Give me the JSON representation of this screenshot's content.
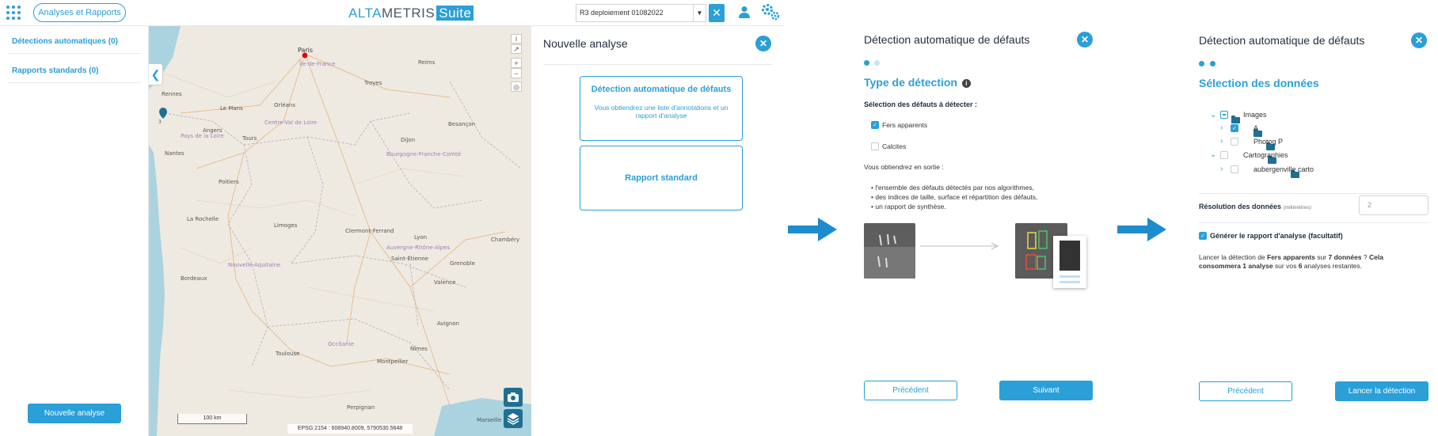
{
  "header": {
    "analyses_button": "Analyses et Rapports",
    "logo_alta": "ALTA",
    "logo_metris": "METRIS",
    "logo_suite": "Suite",
    "project_select_value": "R3 deploiement 01082022",
    "accent": "#2a9fd8"
  },
  "sidebar": {
    "items": [
      {
        "label": "Détections automatiques (0)"
      },
      {
        "label": "Rapports standards (0)"
      }
    ],
    "new_analysis_button": "Nouvelle analyse"
  },
  "map": {
    "scale_label": "100 km",
    "coords_label": "EPSG:2154 : 608940.8009, 5790530.5648",
    "marker_count": "3",
    "labels": [
      "Paris",
      "Île-de-France",
      "Rennes",
      "Nantes",
      "Angers",
      "Tours",
      "Orléans",
      "Le Mans",
      "Troyes",
      "Reims",
      "Dijon",
      "Besançon",
      "Poitiers",
      "Limoges",
      "Clermont-Ferrand",
      "Lyon",
      "Grenoble",
      "Bordeaux",
      "Nouvelle-Aquitaine",
      "Toulouse",
      "Occitanie",
      "Montpellier",
      "Marseille",
      "Nîmes",
      "La Rochelle",
      "Chambéry",
      "Saint-Étienne",
      "Auvergne-Rhône-Alpes",
      "Centre-Val de Loire",
      "Bourgogne-Franche-Comté",
      "Pays de la Loire",
      "Avignon",
      "Perpignan",
      "Valence"
    ]
  },
  "panel1": {
    "title": "Nouvelle analyse",
    "card1_title": "Détection automatique de défauts",
    "card1_desc": "Vous obtiendrez une liste d'annotations et un rapport d'analyse",
    "card2_title": "Rapport standard"
  },
  "panel2": {
    "title": "Détection automatique de défauts",
    "section": "Type de détection",
    "select_label": "Sélection des défauts à détecter :",
    "options": [
      {
        "label": "Fers apparents",
        "checked": true
      },
      {
        "label": "Calcites",
        "checked": false
      }
    ],
    "output_intro": "Vous obtiendrez en sortie :",
    "bullets": [
      "l'ensemble des défauts détectés par nos algorithmes,",
      "des indices de taille, surface et répartition des défauts,",
      "un rapport de synthèse."
    ],
    "prev_button": "Précédent",
    "next_button": "Suivant"
  },
  "panel3": {
    "title": "Détection automatique de défauts",
    "section": "Sélection des données",
    "tree": [
      {
        "label": "Images",
        "level": 0,
        "state": "partial",
        "expanded": true
      },
      {
        "label": "A",
        "level": 1,
        "state": "checked",
        "expanded": false
      },
      {
        "label": "Photog P",
        "level": 1,
        "state": "unchecked",
        "expanded": false
      },
      {
        "label": "Cartographies",
        "level": 0,
        "state": "unchecked",
        "expanded": true
      },
      {
        "label": "aubergenville carto",
        "level": 1,
        "state": "unchecked",
        "expanded": false
      }
    ],
    "resolution_label": "Résolution des données",
    "resolution_unit": "(millimètres)",
    "resolution_value": "2",
    "generate_label": "Générer le rapport d'analyse (facultatif)",
    "launch_text_1": "Lancer la détection de ",
    "launch_bold_1": "Fers apparents",
    "launch_text_2": " sur ",
    "launch_bold_2": "7 données",
    "launch_text_3": " ? ",
    "launch_bold_3": "Cela consommera 1 analyse",
    "launch_text_4": " sur vos ",
    "launch_bold_4": "6",
    "launch_text_5": " analyses restantes.",
    "prev_button": "Précédent",
    "launch_button": "Lancer la détection"
  }
}
